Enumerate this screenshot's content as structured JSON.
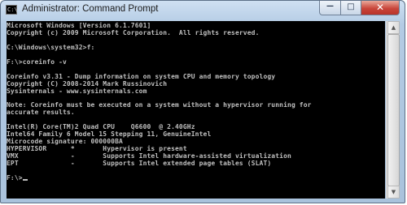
{
  "window": {
    "title": "Administrator: Command Prompt",
    "icon": "console-icon",
    "icon_glyph": "C:\\",
    "minimize_glyph": "—",
    "maximize_glyph": "□",
    "close_glyph": "✕"
  },
  "console": {
    "lines": [
      "Microsoft Windows [Version 6.1.7601]",
      "Copyright (c) 2009 Microsoft Corporation.  All rights reserved.",
      "",
      "C:\\Windows\\system32>f:",
      "",
      "F:\\>coreinfo -v",
      "",
      "Coreinfo v3.31 - Dump information on system CPU and memory topology",
      "Copyright (C) 2008-2014 Mark Russinovich",
      "Sysinternals - www.sysinternals.com",
      "",
      "Note: Coreinfo must be executed on a system without a hypervisor running for",
      "accurate results.",
      "",
      "Intel(R) Core(TM)2 Quad CPU    Q6600  @ 2.40GHz",
      "Intel64 Family 6 Model 15 Stepping 11, GenuineIntel",
      "Microcode signature: 000000BA",
      "HYPERVISOR      *       Hypervisor is present",
      "VMX             -       Supports Intel hardware-assisted virtualization",
      "EPT             -       Supports Intel extended page tables (SLAT)",
      ""
    ],
    "prompt": "F:\\>"
  },
  "scrollbar": {
    "up_glyph": "▲",
    "down_glyph": "▼"
  },
  "colors": {
    "console_bg": "#000000",
    "console_text": "#c0c0c0",
    "close_button": "#c9463b",
    "frame": "#b3cbe4"
  }
}
